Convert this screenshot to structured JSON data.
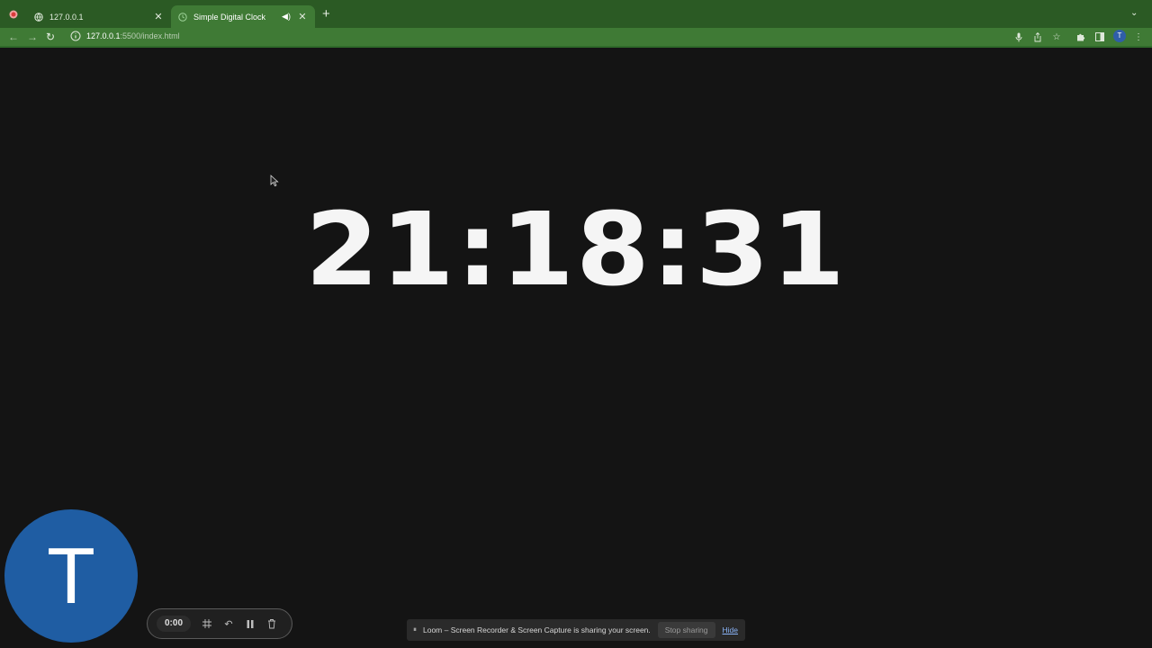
{
  "browser": {
    "tabs": [
      {
        "title": "127.0.0.1",
        "active": false
      },
      {
        "title": "Simple Digital Clock",
        "active": true
      }
    ],
    "address": {
      "host": "127.0.0.1",
      "rest": ":5500/index.html"
    }
  },
  "page": {
    "clock_text": "21:18:31"
  },
  "loom": {
    "avatar_initial": "T",
    "profile_initial": "T",
    "timer": "0:00",
    "share_message": "Loom – Screen Recorder & Screen Capture is sharing your screen.",
    "stop_label": "Stop sharing",
    "hide_label": "Hide"
  },
  "colors": {
    "tabbar": "#2b5a24",
    "toolbar": "#3f7a35",
    "page_bg": "#141414",
    "clock": "#f5f5f5",
    "avatar_bg": "#1f5da3",
    "link": "#8ab4f8"
  }
}
